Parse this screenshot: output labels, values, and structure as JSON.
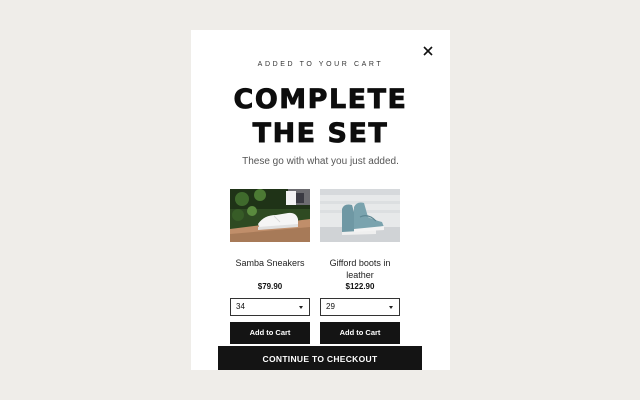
{
  "modal": {
    "eyebrow": "ADDED TO YOUR CART",
    "title_line1": "COMPLETE",
    "title_line2": "THE SET",
    "subtitle": "These go with what you just added.",
    "close_icon": "close-icon"
  },
  "products": [
    {
      "name": "Samba Sneakers",
      "price": "$79.90",
      "size_selected": "34",
      "add_label": "Add to Cart",
      "image": "white-sneakers-photo"
    },
    {
      "name": "Gifford boots in leather",
      "price": "$122.90",
      "size_selected": "29",
      "add_label": "Add to Cart",
      "image": "teal-high-top-boots-photo"
    }
  ],
  "checkout": {
    "label": "CONTINUE TO CHECKOUT"
  },
  "colors": {
    "page_bg": "#efede9",
    "modal_bg": "#ffffff",
    "button_bg": "#141414",
    "button_text": "#ffffff"
  }
}
